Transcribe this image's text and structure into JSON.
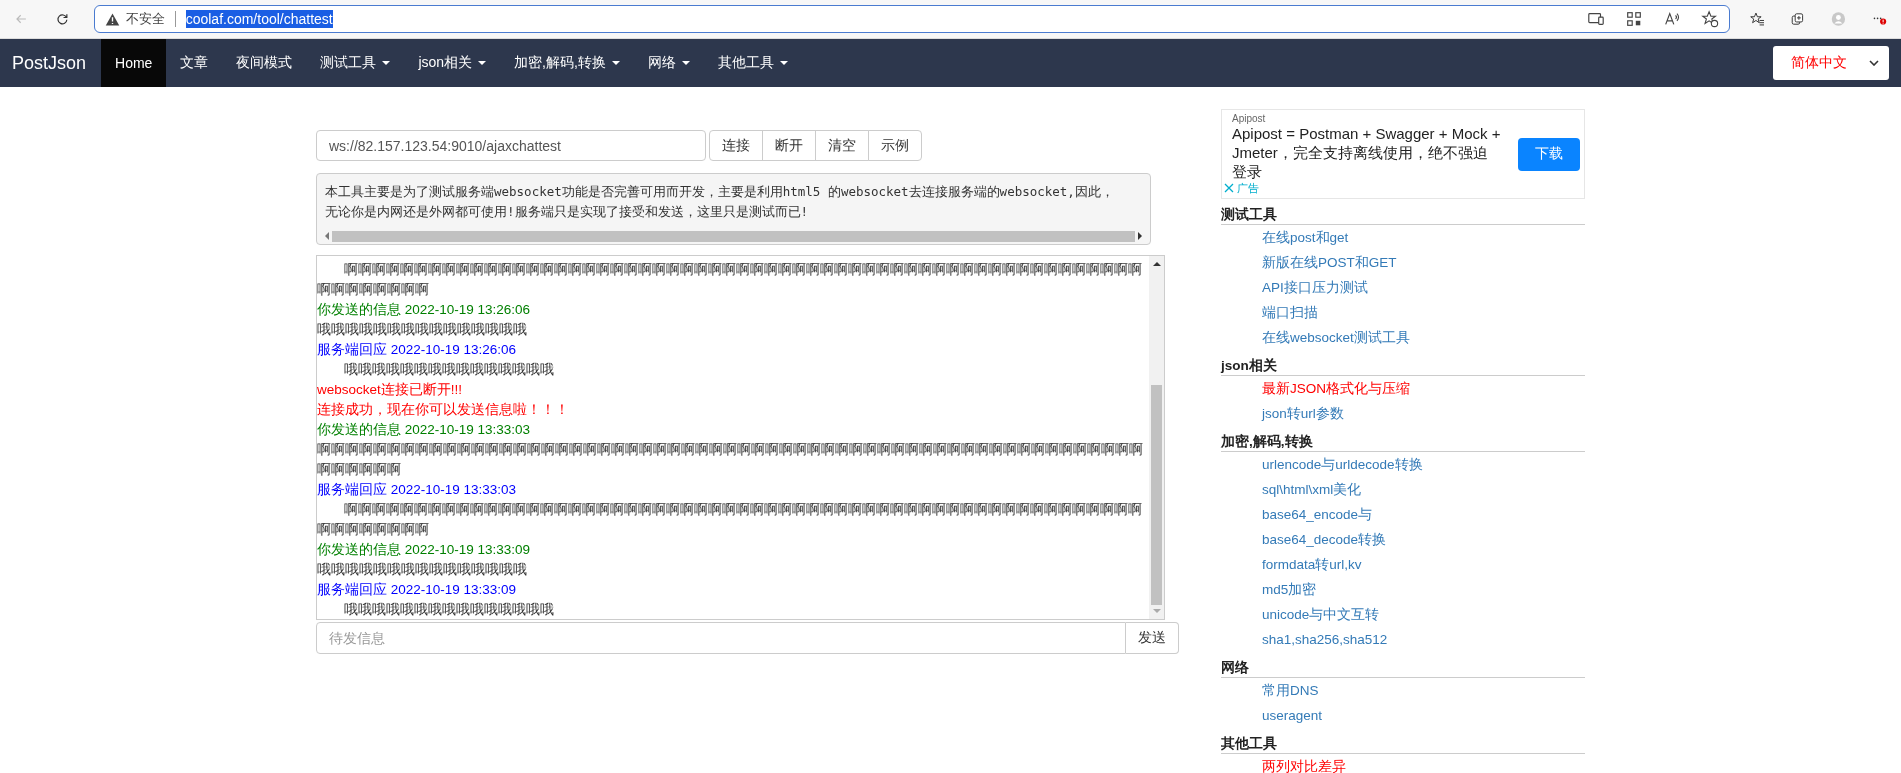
{
  "browser": {
    "security_label": "不安全",
    "url": "coolaf.com/tool/chattest"
  },
  "navbar": {
    "brand": "PostJson",
    "items": [
      {
        "label": "Home",
        "selected": true,
        "dropdown": false
      },
      {
        "label": "文章",
        "selected": false,
        "dropdown": false
      },
      {
        "label": "夜间模式",
        "selected": false,
        "dropdown": false
      },
      {
        "label": "测试工具",
        "selected": false,
        "dropdown": true
      },
      {
        "label": "json相关",
        "selected": false,
        "dropdown": true
      },
      {
        "label": "加密,解码,转换",
        "selected": false,
        "dropdown": true
      },
      {
        "label": "网络",
        "selected": false,
        "dropdown": true
      },
      {
        "label": "其他工具",
        "selected": false,
        "dropdown": true
      }
    ],
    "language": "简体中文"
  },
  "connection": {
    "url_value": "ws://82.157.123.54:9010/ajaxchattest",
    "buttons": [
      "连接",
      "断开",
      "清空",
      "示例"
    ]
  },
  "description": [
    "本工具主要是为了测试服务端websocket功能是否完善可用而开发，主要是利用html5 的websocket去连接服务端的websocket,因此，",
    "无论你是内网还是外网都可使用!服务端只是实现了接受和发送，这里只是测试而已!"
  ],
  "chat_log": [
    {
      "kind": "reply_body",
      "text": "啊啊啊啊啊啊啊啊啊啊啊啊啊啊啊啊啊啊啊啊啊啊啊啊啊啊啊啊啊啊啊啊啊啊啊啊啊啊啊啊啊啊啊啊啊啊啊啊啊啊啊啊啊啊啊啊啊啊啊啊啊啊啊啊啊"
    },
    {
      "kind": "sent_header",
      "text": "你发送的信息 2022-10-19 13:26:06"
    },
    {
      "kind": "sent_body",
      "text": "哦哦哦哦哦哦哦哦哦哦哦哦哦哦哦"
    },
    {
      "kind": "reply_header",
      "text": "服务端回应 2022-10-19 13:26:06"
    },
    {
      "kind": "reply_body",
      "text": "哦哦哦哦哦哦哦哦哦哦哦哦哦哦哦"
    },
    {
      "kind": "alert",
      "text": "websocket连接已断开!!!"
    },
    {
      "kind": "alert",
      "text": "连接成功，现在你可以发送信息啦！！！"
    },
    {
      "kind": "sent_header",
      "text": "你发送的信息 2022-10-19 13:33:03"
    },
    {
      "kind": "sent_body",
      "text": "啊啊啊啊啊啊啊啊啊啊啊啊啊啊啊啊啊啊啊啊啊啊啊啊啊啊啊啊啊啊啊啊啊啊啊啊啊啊啊啊啊啊啊啊啊啊啊啊啊啊啊啊啊啊啊啊啊啊啊啊啊啊啊啊啊"
    },
    {
      "kind": "reply_header",
      "text": "服务端回应 2022-10-19 13:33:03"
    },
    {
      "kind": "reply_body",
      "text": "啊啊啊啊啊啊啊啊啊啊啊啊啊啊啊啊啊啊啊啊啊啊啊啊啊啊啊啊啊啊啊啊啊啊啊啊啊啊啊啊啊啊啊啊啊啊啊啊啊啊啊啊啊啊啊啊啊啊啊啊啊啊啊啊啊"
    },
    {
      "kind": "sent_header",
      "text": "你发送的信息 2022-10-19 13:33:09"
    },
    {
      "kind": "sent_body",
      "text": "哦哦哦哦哦哦哦哦哦哦哦哦哦哦哦"
    },
    {
      "kind": "reply_header",
      "text": "服务端回应 2022-10-19 13:33:09"
    },
    {
      "kind": "reply_body",
      "text": "哦哦哦哦哦哦哦哦哦哦哦哦哦哦哦"
    }
  ],
  "message_input": {
    "placeholder": "待发信息",
    "button": "发送"
  },
  "sidebar": {
    "ad": {
      "advertiser": "Apipost",
      "text": "Apipost = Postman + Swagger + Mock + Jmeter，完全支持离线使用，绝不强迫登录",
      "button": "下载",
      "label": "广告"
    },
    "sections": [
      {
        "title": "测试工具",
        "links": [
          {
            "label": "在线post和get",
            "color": "#337ab7"
          },
          {
            "label": "新版在线POST和GET",
            "color": "#337ab7"
          },
          {
            "label": "API接口压力测试",
            "color": "#337ab7"
          },
          {
            "label": "端口扫描",
            "color": "#337ab7"
          },
          {
            "label": "在线websocket测试工具",
            "color": "#337ab7"
          }
        ]
      },
      {
        "title": "json相关",
        "links": [
          {
            "label": "最新JSON格式化与压缩",
            "color": "#ff0000"
          },
          {
            "label": "json转url参数",
            "color": "#337ab7"
          }
        ]
      },
      {
        "title": "加密,解码,转换",
        "links": [
          {
            "label": "urlencode与urldecode转换",
            "color": "#337ab7"
          },
          {
            "label": "sql\\html\\xml美化",
            "color": "#337ab7"
          },
          {
            "label": "base64_encode与",
            "color": "#337ab7"
          },
          {
            "label": "base64_decode转换",
            "color": "#337ab7"
          },
          {
            "label": "formdata转url,kv",
            "color": "#337ab7"
          },
          {
            "label": "md5加密",
            "color": "#337ab7"
          },
          {
            "label": "unicode与中文互转",
            "color": "#337ab7"
          },
          {
            "label": "sha1,sha256,sha512",
            "color": "#337ab7"
          }
        ]
      },
      {
        "title": "网络",
        "links": [
          {
            "label": "常用DNS",
            "color": "#337ab7"
          },
          {
            "label": "useragent",
            "color": "#337ab7"
          }
        ]
      },
      {
        "title": "其他工具",
        "links": [
          {
            "label": "两列对比差异",
            "color": "#ff0000"
          }
        ]
      }
    ]
  }
}
